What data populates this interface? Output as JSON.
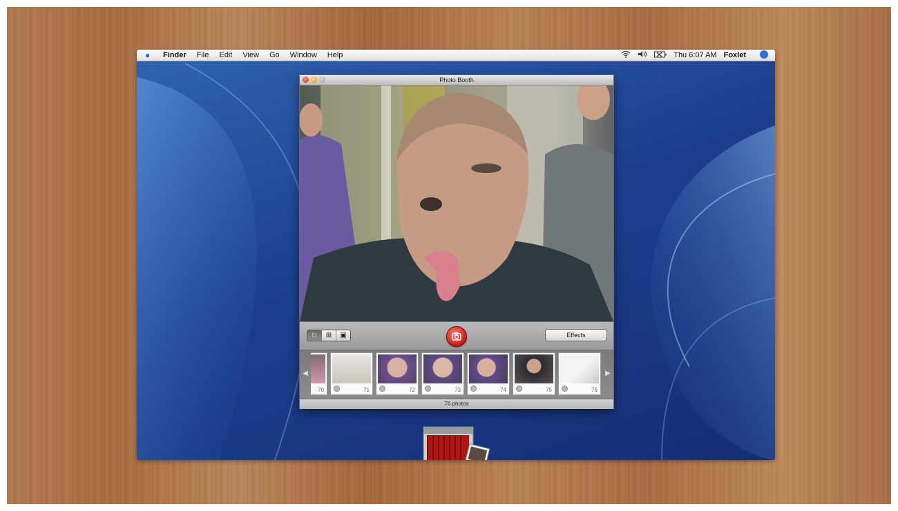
{
  "menubar": {
    "apple_icon": "apple-icon",
    "items": [
      "Finder",
      "File",
      "Edit",
      "View",
      "Go",
      "Window",
      "Help"
    ],
    "clock": "Thu 6:07 AM",
    "user": "Foxlet"
  },
  "window": {
    "title": "Photo Booth",
    "effects_label": "Effects",
    "status": "76 photos",
    "thumbnails": [
      {
        "number": "70"
      },
      {
        "number": "71"
      },
      {
        "number": "72"
      },
      {
        "number": "73"
      },
      {
        "number": "74"
      },
      {
        "number": "75"
      },
      {
        "number": "76"
      }
    ],
    "view_mode": "single",
    "shutter_color": "#d0271b"
  },
  "dock": {
    "items": [
      "photo-booth-icon"
    ]
  }
}
